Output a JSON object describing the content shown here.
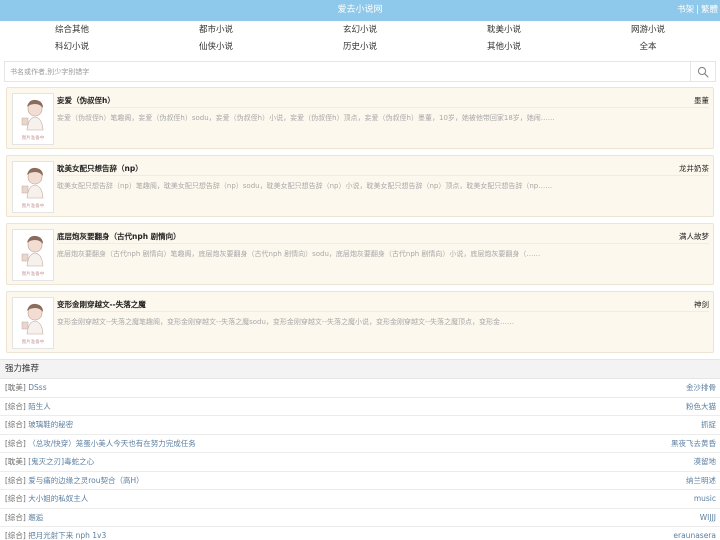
{
  "header": {
    "site_title": "爱去小说网",
    "links": [
      "书架",
      "繁體"
    ],
    "separator": "|"
  },
  "nav": {
    "items": [
      "综合其他",
      "都市小说",
      "玄幻小说",
      "耽美小说",
      "网游小说",
      "科幻小说",
      "仙侠小说",
      "历史小说",
      "其他小说",
      "全本"
    ]
  },
  "search": {
    "placeholder": "书名或作者,别少字别错字",
    "icon": "search-icon"
  },
  "books": [
    {
      "title": "妄爱（伪叔侄h）",
      "author": "墨董",
      "desc": "妄爱（伪叔侄h）笔趣阁，妄爱（伪叔侄h）sodu，妄爱（伪叔侄h）小说，妄爱（伪叔侄h）顶点，妄爱（伪叔侄h）墨董，10岁，她被他带回家18岁，她闹……",
      "cover_caption": "图片准备中"
    },
    {
      "title": "耽美女配只想告辞（np）",
      "author": "龙井奶茶",
      "desc": "耽美女配只想告辞（np）笔趣阁，耽美女配只想告辞（np）sodu，耽美女配只想告辞（np）小说，耽美女配只想告辞（np）顶点，耽美女配只想告辞（np……",
      "cover_caption": "图片准备中"
    },
    {
      "title": "底层炮灰要翻身（古代nph 剧情向）",
      "author": "满人故梦",
      "desc": "底层炮灰要翻身（古代nph 剧情向）笔趣阁，底层炮灰要翻身（古代nph 剧情向）sodu，底层炮灰要翻身（古代nph 剧情向）小说，底层炮灰要翻身（……",
      "cover_caption": "图片准备中"
    },
    {
      "title": "变形金刚穿越文--失落之魔",
      "author": "神剑",
      "desc": "变形金刚穿越文--失落之魔笔趣阁，变形金刚穿越文--失落之魔sodu，变形金刚穿越文--失落之魔小说，变形金刚穿越文--失落之魔顶点，变形金……",
      "cover_caption": "图片准备中"
    }
  ],
  "recommend": {
    "title": "强力推荐",
    "items": [
      {
        "category": "[耽美]",
        "name": "DSss",
        "author": "金沙排骨"
      },
      {
        "category": "[综合]",
        "name": "陌生人",
        "author": "粉色大猫"
      },
      {
        "category": "[综合]",
        "name": "玻璃鞋的秘密",
        "author": "抓捉"
      },
      {
        "category": "[综合]",
        "name": "（总攻/快穿）笼蛋小美人今天也有在努力完成任务",
        "author": "黑夜飞去黄昏"
      },
      {
        "category": "[耽美]",
        "name": "[鬼灭之刃]毒蛇之心",
        "author": "漠留地"
      },
      {
        "category": "[综合]",
        "name": "爱与痛的边缘之灵rou契合（高H）",
        "author": "纳兰明述"
      },
      {
        "category": "[综合]",
        "name": "大小姐的私奴主人",
        "author": "music"
      },
      {
        "category": "[综合]",
        "name": "邂逅",
        "author": "WIJJJ"
      },
      {
        "category": "[综合]",
        "name": "把月光射下来 nph 1v3",
        "author": "eraunasera"
      }
    ]
  },
  "colors": {
    "topbar": "#8ec8ea",
    "book_bg": "#fdf8ee",
    "link": "#5b7fa0"
  }
}
